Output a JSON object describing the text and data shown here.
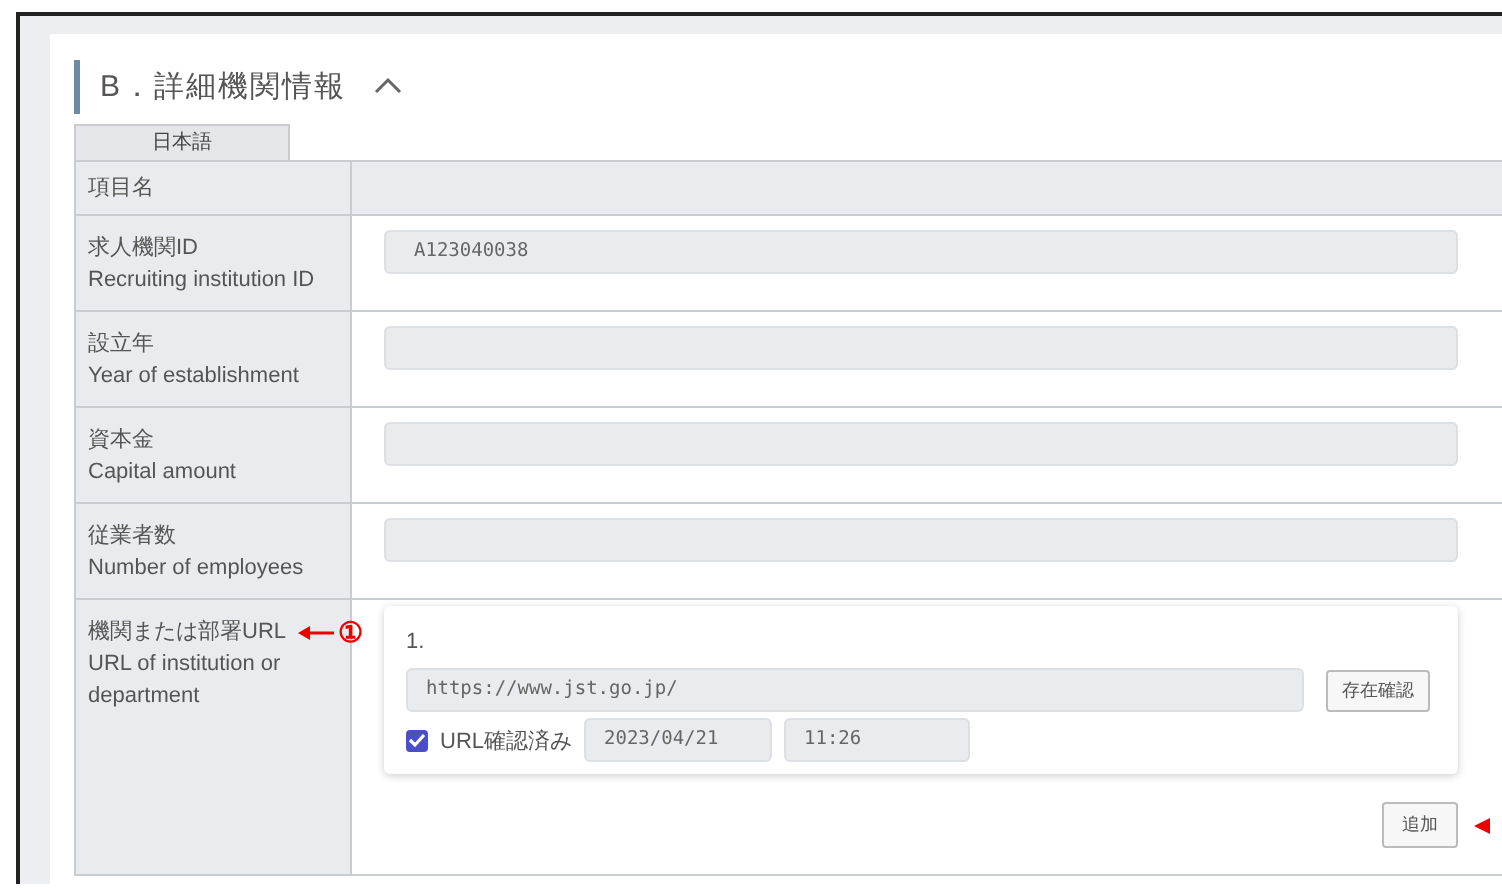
{
  "section": {
    "title": "B．詳細機関情報",
    "expanded": true
  },
  "tabs": [
    {
      "label": "日本語",
      "selected": true
    }
  ],
  "table": {
    "header": "項目名",
    "rows": [
      {
        "kind": "text",
        "label_ja": "求人機関ID",
        "label_en": "Recruiting institution ID",
        "value": "A123040038"
      },
      {
        "kind": "text",
        "label_ja": "設立年",
        "label_en": "Year of establishment"
      },
      {
        "kind": "text",
        "label_ja": "資本金",
        "label_en": "Capital amount"
      },
      {
        "kind": "text",
        "label_ja": "従業者数",
        "label_en": "Number of employees"
      },
      {
        "kind": "url_list",
        "label_ja": "機関または部署URL",
        "label_en": "URL of institution or department",
        "annotation": "①",
        "items": [
          {
            "number": "1.",
            "url": "https://www.jst.go.jp/",
            "check_button": "存在確認",
            "confirmed": true,
            "confirmed_label": "URL確認済み",
            "date": "2023/04/21",
            "time": "11:26"
          }
        ],
        "add_button": "追加",
        "add_annotated": true
      }
    ]
  }
}
